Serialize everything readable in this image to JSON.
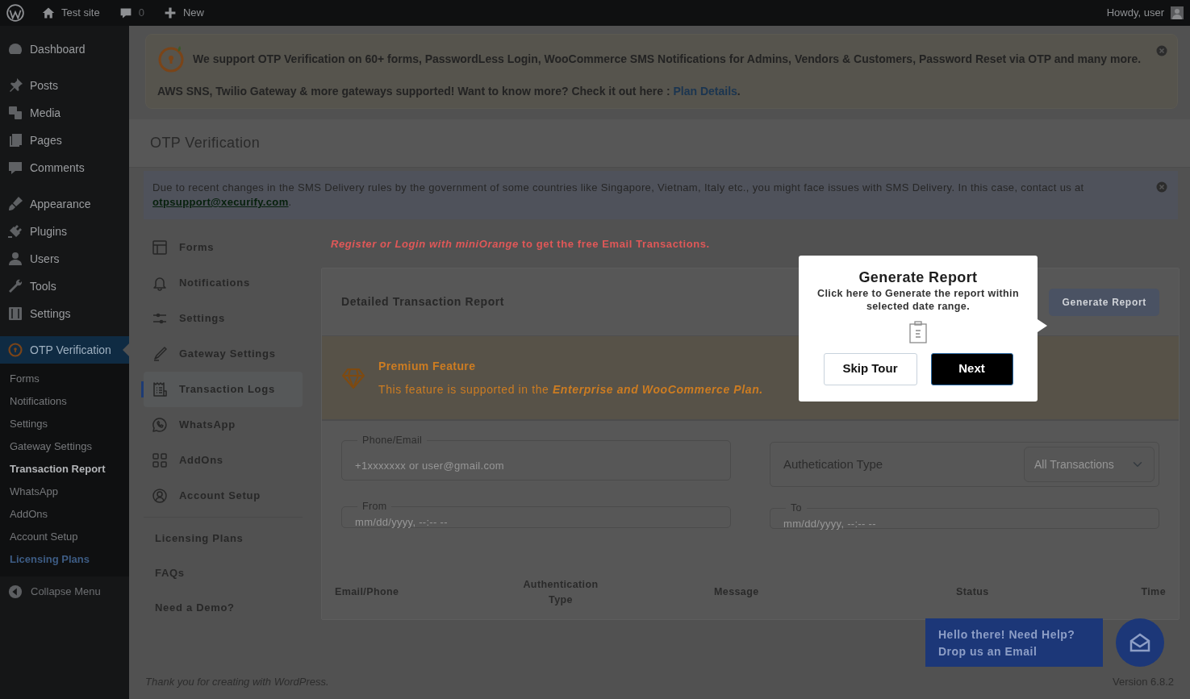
{
  "admin_bar": {
    "site": "Test site",
    "comments": "0",
    "new": "New",
    "greeting": "Howdy, user"
  },
  "sidebar": {
    "groups": [
      [
        {
          "label": "Dashboard",
          "selected": false
        }
      ],
      [
        {
          "label": "Posts",
          "selected": false
        },
        {
          "label": "Media",
          "selected": false
        },
        {
          "label": "Pages",
          "selected": false
        },
        {
          "label": "Comments",
          "selected": false
        }
      ],
      [
        {
          "label": "Appearance",
          "selected": false
        },
        {
          "label": "Plugins",
          "selected": false
        },
        {
          "label": "Users",
          "selected": false
        },
        {
          "label": "Tools",
          "selected": false
        },
        {
          "label": "Settings",
          "selected": false
        }
      ],
      [
        {
          "label": "OTP Verification",
          "selected": true,
          "children": [
            {
              "label": "Forms",
              "selected": false,
              "highlighted": false
            },
            {
              "label": "Notifications",
              "selected": false,
              "highlighted": false
            },
            {
              "label": "Settings",
              "selected": false,
              "highlighted": false
            },
            {
              "label": "Gateway Settings",
              "selected": false,
              "highlighted": false
            },
            {
              "label": "Transaction Report",
              "selected": true,
              "highlighted": false
            },
            {
              "label": "WhatsApp",
              "selected": false,
              "highlighted": false
            },
            {
              "label": "AddOns",
              "selected": false,
              "highlighted": false
            },
            {
              "label": "Account Setup",
              "selected": false,
              "highlighted": false
            },
            {
              "label": "Licensing Plans",
              "selected": false,
              "highlighted": true
            }
          ]
        }
      ]
    ],
    "collapse": "Collapse Menu"
  },
  "promo_banner": {
    "line1": "We support OTP Verification on 60+ forms, PasswordLess Login, WooCommerce SMS Notifications for Admins, Vendors & Customers, Password Reset via OTP and many more.",
    "line2": "AWS SNS, Twilio Gateway & more gateways supported! Want to know more? Check it out here : ",
    "link": "Plan Details",
    "suffix": "."
  },
  "page_title": "OTP Verification",
  "notice": {
    "text": "Due to recent changes in the SMS Delivery rules by the government of some countries like Singapore, Vietnam, Italy etc., you might face issues with SMS Delivery. In this case, contact us at ",
    "email": "otpsupport@xecurify.com",
    "suffix": "."
  },
  "plugin_nav": {
    "items": [
      {
        "label": "Forms",
        "selected": false
      },
      {
        "label": "Notifications",
        "selected": false
      },
      {
        "label": "Settings",
        "selected": false
      },
      {
        "label": "Gateway Settings",
        "selected": false
      },
      {
        "label": "Transaction Logs",
        "selected": true
      },
      {
        "label": "WhatsApp",
        "selected": false
      },
      {
        "label": "AddOns",
        "selected": false
      },
      {
        "label": "Account Setup",
        "selected": false
      }
    ],
    "links": [
      "Licensing Plans",
      "FAQs",
      "Need a Demo?"
    ]
  },
  "register_notice": {
    "link": "Register or Login with miniOrange",
    "text": " to get the free Email Transactions."
  },
  "report": {
    "title": "Detailed Transaction Report",
    "button": "Generate Report",
    "premium": {
      "title": "Premium Feature",
      "text": "This feature is supported in the ",
      "link": "Enterprise and WooCommerce Plan."
    },
    "phone": {
      "label": "Phone/Email",
      "placeholder": "+1xxxxxxx or user@gmail.com"
    },
    "auth_type": {
      "label": "Authetication Type",
      "value": "All Transactions"
    },
    "from": {
      "label": "From",
      "placeholder": "mm/dd/yyyy, --:-- --"
    },
    "to": {
      "label": "To",
      "placeholder": "mm/dd/yyyy, --:-- --"
    },
    "columns": [
      "Email/Phone",
      "Authentication Type",
      "Message",
      "Status",
      "Time"
    ]
  },
  "tour": {
    "title": "Generate Report",
    "text": "Click here to Generate the report within selected date range.",
    "skip": "Skip Tour",
    "next": "Next"
  },
  "help": {
    "line1": "Hello there! Need Help?",
    "line2": "Drop us an Email"
  },
  "footer": {
    "text": "Thank you for creating with ",
    "link": "WordPress",
    "suffix": ".",
    "version": "Version 6.8.2"
  }
}
